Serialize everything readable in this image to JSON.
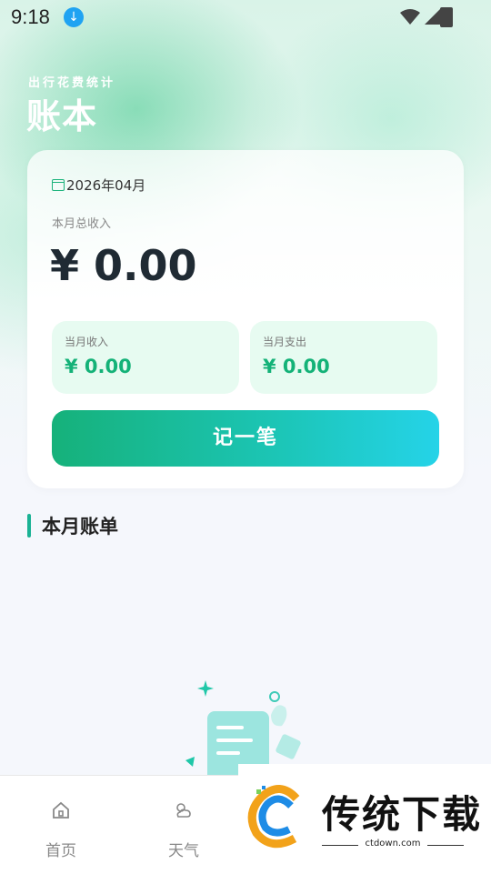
{
  "status_bar": {
    "time": "9:18"
  },
  "header": {
    "subtitle": "出行花费统计",
    "title": "账本"
  },
  "summary": {
    "date": "2026年04月",
    "total_label": "本月总收入",
    "total_value": "¥ 0.00",
    "income_label": "当月收入",
    "income_value": "¥ 0.00",
    "expense_label": "当月支出",
    "expense_value": "¥ 0.00",
    "record_button": "记一笔"
  },
  "section": {
    "title": "本月账单"
  },
  "tabs": [
    {
      "label": "首页",
      "icon": "home-icon"
    },
    {
      "label": "天气",
      "icon": "weather-icon"
    }
  ],
  "watermark": {
    "text": "传统下载",
    "url": "ctdown.com"
  },
  "colors": {
    "accent": "#14b278",
    "button_start": "#16b17a",
    "button_end": "#25d3e8"
  }
}
